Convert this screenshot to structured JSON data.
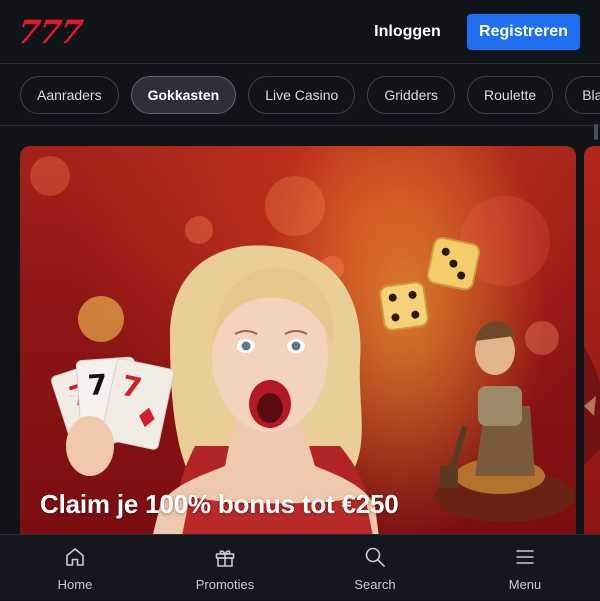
{
  "header": {
    "logo": "777",
    "login_label": "Inloggen",
    "register_label": "Registreren"
  },
  "categories": [
    {
      "label": "Aanraders",
      "active": false
    },
    {
      "label": "Gokkasten",
      "active": true
    },
    {
      "label": "Live Casino",
      "active": false
    },
    {
      "label": "Gridders",
      "active": false
    },
    {
      "label": "Roulette",
      "active": false
    },
    {
      "label": "Blackjack",
      "active": false
    }
  ],
  "banner": {
    "title": "Claim je 100% bonus tot €250"
  },
  "bottom_nav": [
    {
      "label": "Home",
      "icon": "home-icon"
    },
    {
      "label": "Promoties",
      "icon": "gift-icon"
    },
    {
      "label": "Search",
      "icon": "search-icon"
    },
    {
      "label": "Menu",
      "icon": "menu-icon"
    }
  ],
  "colors": {
    "background": "#0f1418",
    "brand_red": "#e3192b",
    "register_blue": "#1f6ff0",
    "active_chip": "#2b3137"
  }
}
